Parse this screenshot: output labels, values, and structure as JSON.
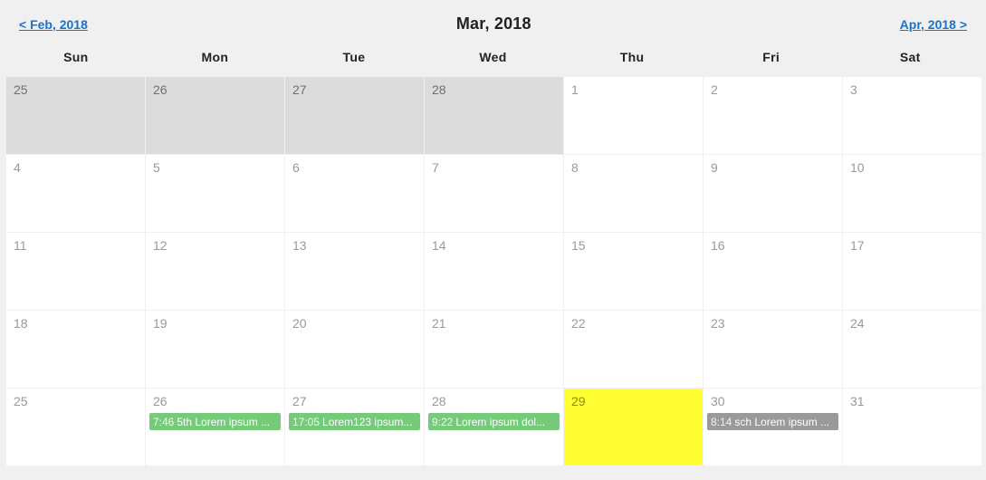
{
  "nav": {
    "prev": "< Feb, 2018",
    "title": "Mar, 2018",
    "next": "Apr, 2018 >"
  },
  "weekdays": [
    "Sun",
    "Mon",
    "Tue",
    "Wed",
    "Thu",
    "Fri",
    "Sat"
  ],
  "cells": [
    {
      "day": "25",
      "otherMonth": true
    },
    {
      "day": "26",
      "otherMonth": true
    },
    {
      "day": "27",
      "otherMonth": true
    },
    {
      "day": "28",
      "otherMonth": true
    },
    {
      "day": "1"
    },
    {
      "day": "2"
    },
    {
      "day": "3"
    },
    {
      "day": "4"
    },
    {
      "day": "5"
    },
    {
      "day": "6"
    },
    {
      "day": "7"
    },
    {
      "day": "8"
    },
    {
      "day": "9"
    },
    {
      "day": "10"
    },
    {
      "day": "11"
    },
    {
      "day": "12"
    },
    {
      "day": "13"
    },
    {
      "day": "14"
    },
    {
      "day": "15"
    },
    {
      "day": "16"
    },
    {
      "day": "17"
    },
    {
      "day": "18"
    },
    {
      "day": "19"
    },
    {
      "day": "20"
    },
    {
      "day": "21"
    },
    {
      "day": "22"
    },
    {
      "day": "23"
    },
    {
      "day": "24"
    },
    {
      "day": "25"
    },
    {
      "day": "26",
      "events": [
        {
          "time": "7:46",
          "title": "5th Lorem ipsum ...",
          "color": "green"
        }
      ]
    },
    {
      "day": "27",
      "events": [
        {
          "time": "17:05",
          "title": "Lorem123 ipsum...",
          "color": "green"
        }
      ]
    },
    {
      "day": "28",
      "events": [
        {
          "time": "9:22",
          "title": "Lorem ipsum dol...",
          "color": "green"
        }
      ]
    },
    {
      "day": "29",
      "today": true
    },
    {
      "day": "30",
      "events": [
        {
          "time": "8:14",
          "title": "sch Lorem ipsum ...",
          "color": "gray"
        }
      ]
    },
    {
      "day": "31"
    }
  ]
}
